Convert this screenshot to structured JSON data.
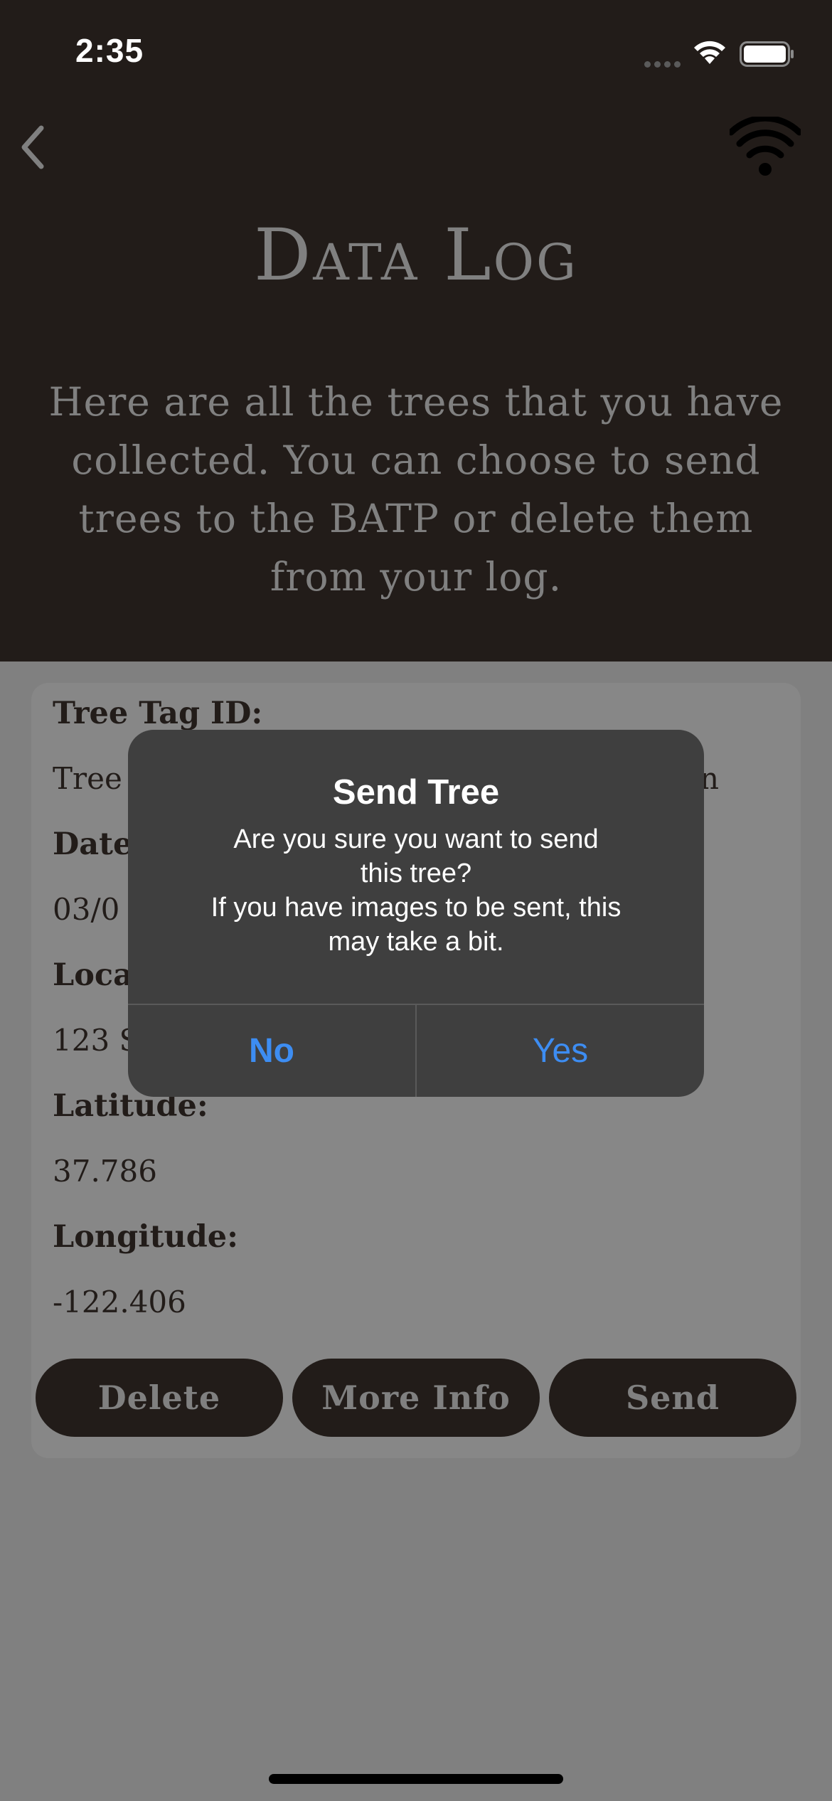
{
  "status_bar": {
    "time": "2:35"
  },
  "nav": {
    "back_icon": "chevron-left-icon",
    "connection_icon": "wifi-icon"
  },
  "header": {
    "title": "Data Log",
    "subtitle": "Here are all the trees that you have collected. You can choose to send trees to the BATP or delete them from your log."
  },
  "card": {
    "tag_label": "Tree Tag ID:",
    "tag_value_left": "Tree",
    "tag_value_right": "n",
    "date_label": "Date",
    "date_value": "03/0",
    "location_label": "Loca",
    "location_value": "123 S",
    "latitude_label": "Latitude:",
    "latitude_value": "37.786",
    "longitude_label": "Longitude:",
    "longitude_value": "-122.406",
    "buttons": {
      "delete": "Delete",
      "more_info": "More Info",
      "send": "Send"
    }
  },
  "dialog": {
    "title": "Send Tree",
    "message": "Are you sure you want to send\nthis tree?\nIf you have images to be sent, this\nmay take a bit.",
    "no": "No",
    "yes": "Yes"
  },
  "colors": {
    "header_bg": "#221c19",
    "dimmed_bg": "#808080",
    "dialog_bg": "#3f3f3f",
    "action_blue": "#3d8df2"
  }
}
